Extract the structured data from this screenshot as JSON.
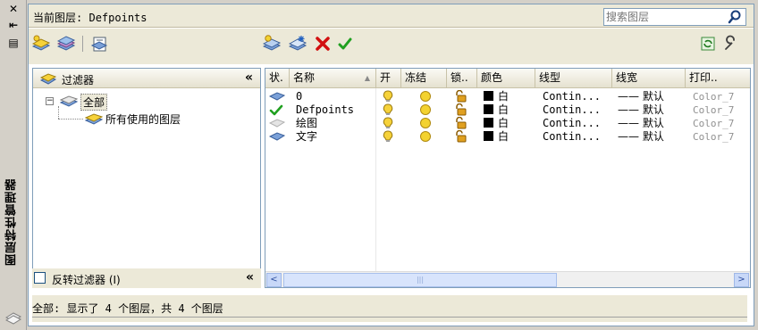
{
  "palette": {
    "accent": "#316ac5",
    "panel_border": "#7f9db9",
    "chrome": "#ece9d8",
    "layer_blue": "#7aa0d8",
    "bulb_yellow": "#f6d23a",
    "sun_yellow": "#f3d230",
    "lock_gold": "#e0a020",
    "delete_red": "#d21010",
    "check_green": "#20a020"
  },
  "strip": {
    "close_glyph": "✕",
    "autohide_glyph": "⇤",
    "properties_glyph": "▤",
    "title": "图层特性管理器"
  },
  "header": {
    "current_layer_label": "当前图层:",
    "current_layer_value": "Defpoints",
    "search_placeholder": "搜索图层",
    "search_icon": "magnifier-icon"
  },
  "toolbar": {
    "left_icons": [
      "new-property-filter-icon",
      "new-group-filter-icon",
      "layer-states-manager-icon"
    ],
    "right_icons": [
      "new-layer-icon",
      "new-layer-vp-frozen-icon",
      "delete-layer-icon",
      "set-current-icon"
    ],
    "far_right_icons": [
      "refresh-icon",
      "settings-icon"
    ]
  },
  "filters": {
    "header": "过滤器",
    "collapse_glyph": "«",
    "tree": [
      {
        "label": "全部",
        "expander": "−",
        "selected": true
      },
      {
        "label": "所有使用的图层",
        "expander": "",
        "selected": false
      }
    ],
    "invert_label": "反转过滤器 (I)",
    "invert_checked": false
  },
  "grid": {
    "columns": [
      "状.",
      "名称",
      "开",
      "冻结",
      "锁..",
      "颜色",
      "线型",
      "线宽",
      "打印.."
    ],
    "sort_glyph": "▲",
    "rows": [
      {
        "status": "layer",
        "name": "0",
        "on": true,
        "frozen": false,
        "locked": false,
        "color_name": "白",
        "color_hex": "#000000",
        "linetype": "Contin...",
        "lineweight_line": "——",
        "lineweight": "默认",
        "plot_style": "Color_7"
      },
      {
        "status": "current",
        "name": "Defpoints",
        "on": true,
        "frozen": false,
        "locked": false,
        "color_name": "白",
        "color_hex": "#000000",
        "linetype": "Contin...",
        "lineweight_line": "——",
        "lineweight": "默认",
        "plot_style": "Color_7"
      },
      {
        "status": "layer-empty",
        "name": "绘图",
        "on": true,
        "frozen": false,
        "locked": false,
        "color_name": "白",
        "color_hex": "#000000",
        "linetype": "Contin...",
        "lineweight_line": "——",
        "lineweight": "默认",
        "plot_style": "Color_7"
      },
      {
        "status": "layer",
        "name": "文字",
        "on": true,
        "frozen": false,
        "locked": false,
        "color_name": "白",
        "color_hex": "#000000",
        "linetype": "Contin...",
        "lineweight_line": "——",
        "lineweight": "默认",
        "plot_style": "Color_7"
      }
    ],
    "scroll_left_glyph": "<",
    "scroll_right_glyph": ">",
    "thumb_grip_glyph": "|||"
  },
  "status_bar": {
    "text": "全部: 显示了 4 个图层，共 4 个图层"
  }
}
